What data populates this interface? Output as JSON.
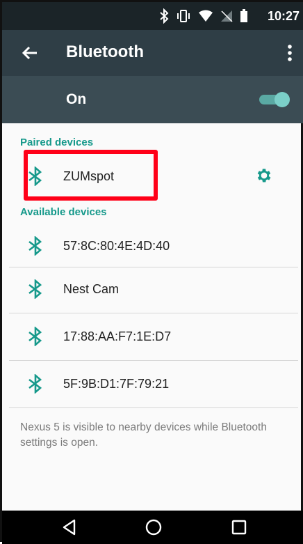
{
  "status": {
    "time": "10:27"
  },
  "appbar": {
    "title": "Bluetooth"
  },
  "toggle": {
    "label": "On",
    "on": true
  },
  "paired": {
    "header": "Paired devices",
    "devices": [
      {
        "name": "ZUMspot"
      }
    ]
  },
  "available": {
    "header": "Available devices",
    "devices": [
      {
        "name": "57:8C:80:4E:4D:40"
      },
      {
        "name": "Nest Cam"
      },
      {
        "name": "17:88:AA:F7:1E:D7"
      },
      {
        "name": "5F:9B:D1:7F:79:21"
      }
    ]
  },
  "footer": {
    "text": "Nexus 5 is visible to nearby devices while Bluetooth settings is open."
  },
  "colors": {
    "accent": "#16998b",
    "highlight": "#ff0018",
    "appbar": "#2f3e46"
  }
}
